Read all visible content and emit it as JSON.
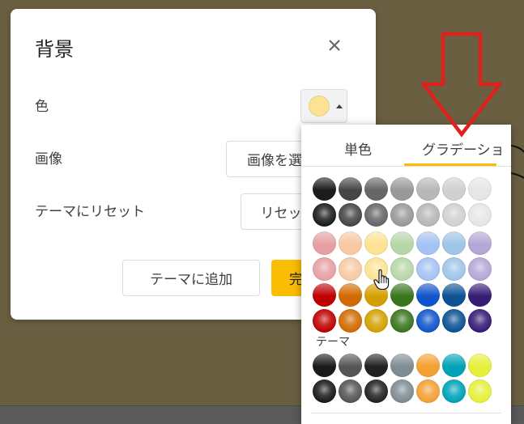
{
  "dialog": {
    "title": "背景",
    "color_label": "色",
    "image_label": "画像",
    "reset_label": "テーマにリセット",
    "choose_image_button": "画像を選",
    "reset_button": "リセッ",
    "add_to_theme_button": "テーマに追加",
    "done_button": "完",
    "selected_color": "#fde293"
  },
  "palette": {
    "tabs": [
      "単色",
      "グラデーショ"
    ],
    "theme_label": "テーマ",
    "grays": [
      "#1c1c1c",
      "#454545",
      "#666666",
      "#999999",
      "#b7b7b7",
      "#d0d0d0",
      "#e6e6e6"
    ],
    "light_colors": [
      "#e6a0a3",
      "#f8c9a3",
      "#fde293",
      "#b7d7a8",
      "#a4c2f4",
      "#9fc5e8",
      "#b4a7d6"
    ],
    "dark_colors": [
      "#c00000",
      "#d26a00",
      "#d4a000",
      "#38761d",
      "#1155cc",
      "#0b5394",
      "#351c75"
    ],
    "theme_colors": [
      "#1a1a1a",
      "#555555",
      "#222222",
      "#7f8c94",
      "#f4a033",
      "#00a2b8",
      "#e6f03a"
    ]
  }
}
